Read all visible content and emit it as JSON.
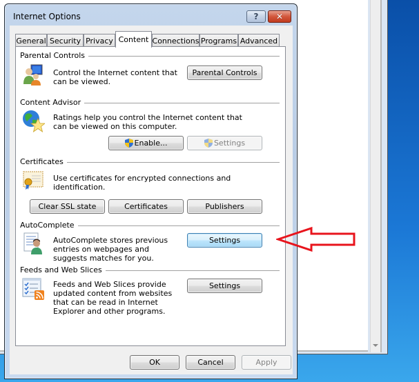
{
  "dialog": {
    "title": "Internet Options",
    "help_glyph": "?",
    "close_glyph": "✕"
  },
  "tabs": [
    {
      "label": "General",
      "active": false
    },
    {
      "label": "Security",
      "active": false
    },
    {
      "label": "Privacy",
      "active": false
    },
    {
      "label": "Content",
      "active": true
    },
    {
      "label": "Connections",
      "active": false
    },
    {
      "label": "Programs",
      "active": false
    },
    {
      "label": "Advanced",
      "active": false
    }
  ],
  "sections": {
    "parental": {
      "title": "Parental Controls",
      "icon": "parental-controls-icon",
      "description": "Control the Internet content that can be viewed.",
      "button": "Parental Controls"
    },
    "advisor": {
      "title": "Content Advisor",
      "icon": "globe-star-icon",
      "description": "Ratings help you control the Internet content that can be viewed on this computer.",
      "enable_button": "Enable...",
      "settings_button": "Settings"
    },
    "certificates": {
      "title": "Certificates",
      "icon": "certificate-icon",
      "description": "Use certificates for encrypted connections and identification.",
      "clear_ssl_button": "Clear SSL state",
      "certificates_button": "Certificates",
      "publishers_button": "Publishers"
    },
    "autocomplete": {
      "title": "AutoComplete",
      "icon": "autocomplete-icon",
      "description": "AutoComplete stores previous entries on webpages and suggests matches for you.",
      "settings_button": "Settings"
    },
    "feeds": {
      "title": "Feeds and Web Slices",
      "icon": "feeds-icon",
      "description": "Feeds and Web Slices provide updated content from websites that can be read in Internet Explorer and other programs.",
      "settings_button": "Settings"
    }
  },
  "footer": {
    "ok": "OK",
    "cancel": "Cancel",
    "apply": "Apply"
  },
  "annotation": {
    "arrow_color": "#e8141c",
    "points_to": "AutoComplete Settings"
  }
}
